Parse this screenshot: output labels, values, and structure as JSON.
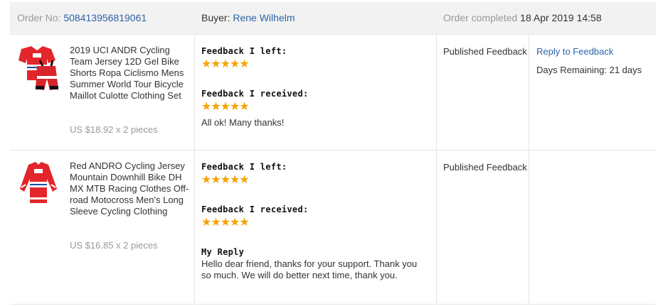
{
  "header": {
    "order_no_label": "Order No:",
    "order_no": "508413956819061",
    "buyer_label": "Buyer:",
    "buyer_name": "Rene Wilhelm",
    "status_label": "Order completed",
    "status_date": "18 Apr 2019 14:58"
  },
  "orders": [
    {
      "title": "2019 UCI ANDR Cycling Team Jersey 12D Gel Bike Shorts Ropa Ciclismo Mens Summer World Tour Bicycle Maillot Culotte Clothing Set",
      "price": "US $18.92 x 2 pieces",
      "feedback_left_label": "Feedback I left:",
      "feedback_left_stars": "★★★★★",
      "feedback_received_label": "Feedback I received:",
      "feedback_received_stars": "★★★★★",
      "feedback_received_text": "All ok! Many thanks!",
      "status": "Published Feedback",
      "action_link": "Reply to Feedback",
      "days_remaining": "Days Remaining: 21 days"
    },
    {
      "title": "Red ANDRO Cycling Jersey Mountain Downhill Bike DH MX MTB Racing Clothes Off-road Motocross Men's Long Sleeve Cycling Clothing",
      "price": "US $16.85 x 2 pieces",
      "feedback_left_label": "Feedback I left:",
      "feedback_left_stars": "★★★★★",
      "feedback_received_label": "Feedback I received:",
      "feedback_received_stars": "★★★★★",
      "reply_label": "My Reply",
      "reply_text": "Hello dear friend, thanks for your support. Thank you so much. We will do better next time, thank you.",
      "status": "Published Feedback"
    }
  ],
  "colors": {
    "link": "#2d63a8",
    "star": "#f5a300",
    "header_bg": "#f2f2f2",
    "muted": "#999999"
  },
  "icons": [
    "cycling-kit-thumbnail",
    "cycling-jersey-thumbnail"
  ]
}
